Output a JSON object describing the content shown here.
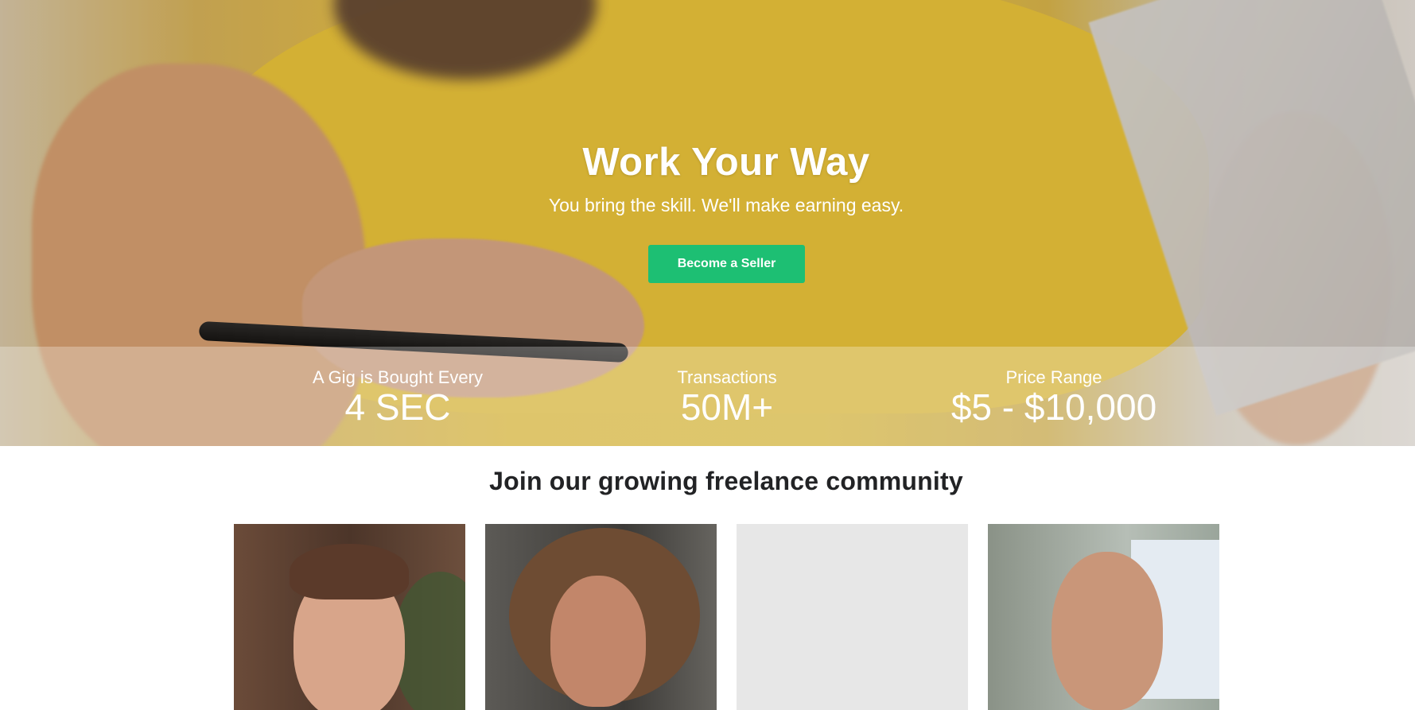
{
  "hero": {
    "title": "Work Your Way",
    "subtitle": "You bring the skill. We'll make earning easy.",
    "cta_label": "Become a Seller",
    "cta_color": "#1dbf73"
  },
  "stats": [
    {
      "label": "A Gig is Bought Every",
      "value": "4 SEC"
    },
    {
      "label": "Transactions",
      "value": "50M+"
    },
    {
      "label": "Price Range",
      "value": "$5 - $10,000"
    }
  ],
  "community": {
    "title": "Join our growing freelance community"
  },
  "colors": {
    "accent": "#1dbf73",
    "heading_dark": "#222325"
  }
}
